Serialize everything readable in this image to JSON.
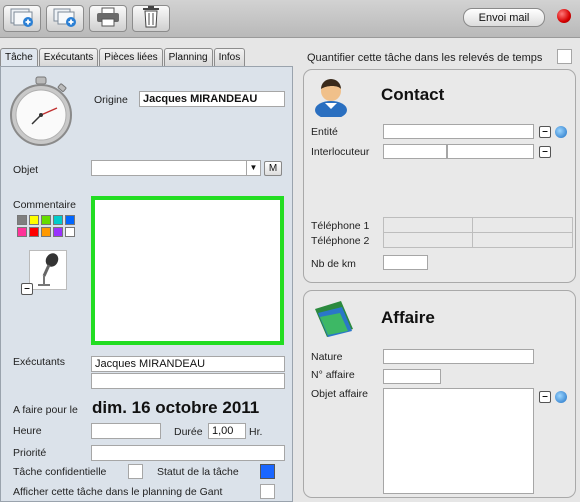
{
  "toolbar": {
    "icons": [
      "add-document-icon",
      "add-copy-icon",
      "printer-icon",
      "trash-icon"
    ],
    "envoi_label": "Envoi mail",
    "status_color": "#e00000"
  },
  "tabs": [
    "Tâche",
    "Exécutants",
    "Pièces liées",
    "Planning",
    "Infos"
  ],
  "task": {
    "origine_label": "Origine",
    "origine_value": "Jacques MIRANDEAU",
    "objet_label": "Objet",
    "objet_value": "",
    "objet_m": "M",
    "commentaire_label": "Commentaire",
    "colors": [
      "#7f7f7f",
      "#ffff00",
      "#66dd00",
      "#00cccc",
      "#0066ff",
      "#ff3399",
      "#ff0000",
      "#ff9900",
      "#9933ff",
      "#ffffff"
    ],
    "comment_border_color": "#22dd22",
    "executants_label": "Exécutants",
    "executants": [
      "Jacques MIRANDEAU",
      ""
    ],
    "afaire_label": "A faire pour le",
    "afaire_value": "dim. 16 octobre 2011",
    "heure_label": "Heure",
    "heure_value": "",
    "duree_label": "Durée",
    "duree_value": "1,00",
    "duree_unit": "Hr.",
    "priorite_label": "Priorité",
    "priorite_value": "",
    "confidentielle_label": "Tâche confidentielle",
    "statut_label": "Statut de la tâche",
    "statut_color": "#1a66ff",
    "gant_label": "Afficher cette tâche dans le planning de Gant"
  },
  "quantifier_label": "Quantifier cette tâche dans les relevés de temps",
  "contact": {
    "title": "Contact",
    "entite_label": "Entité",
    "entite_value": "",
    "interlocuteur_label": "Interlocuteur",
    "tel1_label": "Téléphone 1",
    "tel2_label": "Téléphone 2",
    "km_label": "Nb de km",
    "km_value": ""
  },
  "affaire": {
    "title": "Affaire",
    "nature_label": "Nature",
    "nature_value": "",
    "numero_label": "N° affaire",
    "numero_value": "",
    "objet_label": "Objet affaire",
    "objet_value": ""
  }
}
